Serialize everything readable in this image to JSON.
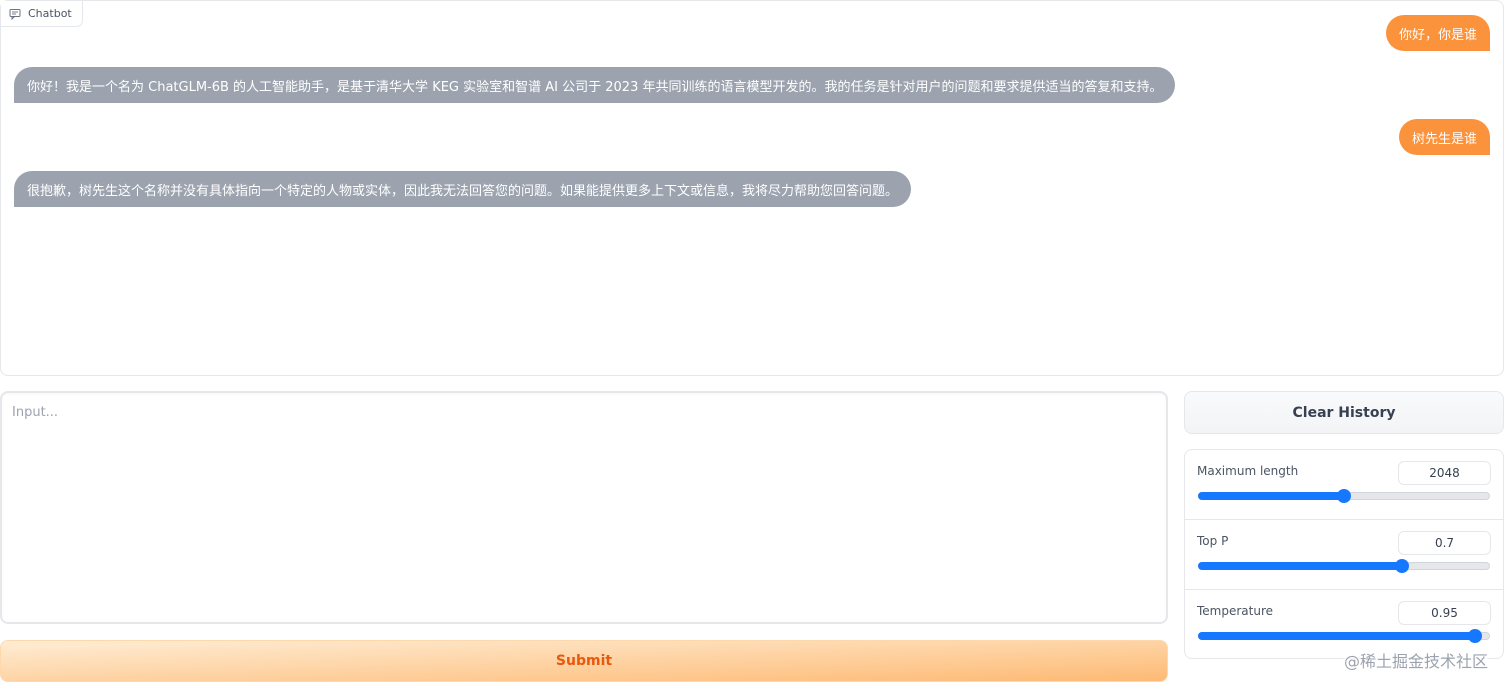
{
  "chatbot": {
    "label": "Chatbot",
    "messages": [
      {
        "role": "user",
        "text": "你好，你是谁"
      },
      {
        "role": "bot",
        "text": "你好！我是一个名为 ChatGLM-6B 的人工智能助手，是基于清华大学 KEG 实验室和智谱 AI 公司于 2023 年共同训练的语言模型开发的。我的任务是针对用户的问题和要求提供适当的答复和支持。"
      },
      {
        "role": "user",
        "text": "树先生是谁"
      },
      {
        "role": "bot",
        "text": "很抱歉，树先生这个名称并没有具体指向一个特定的人物或实体，因此我无法回答您的问题。如果能提供更多上下文或信息，我将尽力帮助您回答问题。"
      }
    ]
  },
  "input": {
    "placeholder": "Input...",
    "value": ""
  },
  "submit_label": "Submit",
  "clear_label": "Clear History",
  "sliders": [
    {
      "label": "Maximum length",
      "value": "2048",
      "fraction": 0.5
    },
    {
      "label": "Top P",
      "value": "0.7",
      "fraction": 0.7
    },
    {
      "label": "Temperature",
      "value": "0.95",
      "fraction": 0.95
    }
  ],
  "watermark": "@稀土掘金技术社区",
  "colors": {
    "accent": "#fb923c",
    "slider": "#1677ff",
    "bot_bubble": "#9ca3af"
  }
}
